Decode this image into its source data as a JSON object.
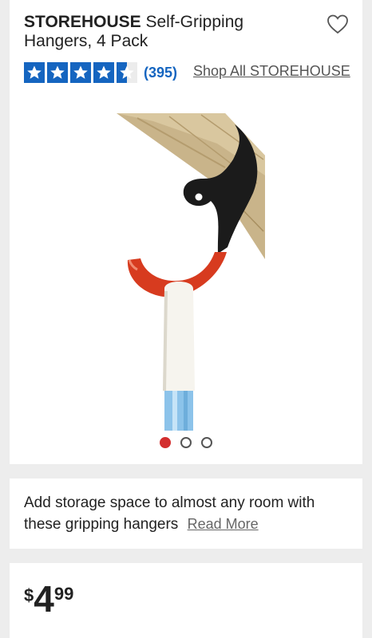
{
  "product": {
    "brand": "STOREHOUSE",
    "name": "Self-Gripping Hangers, 4 Pack",
    "rating": 4.5,
    "review_count": "(395)",
    "shop_link": "Shop All STOREHOUSE",
    "image_count": 3,
    "active_image": 1
  },
  "description": {
    "text": "Add storage space to almost any room with these gripping hangers",
    "read_more": "Read More"
  },
  "price": {
    "currency": "$",
    "dollars": "4",
    "cents": "99"
  },
  "colors": {
    "star_blue": "#1565c0",
    "active_dot": "#d32f2f"
  },
  "icons": [
    "heart-icon",
    "star-icon",
    "star-half-icon"
  ]
}
